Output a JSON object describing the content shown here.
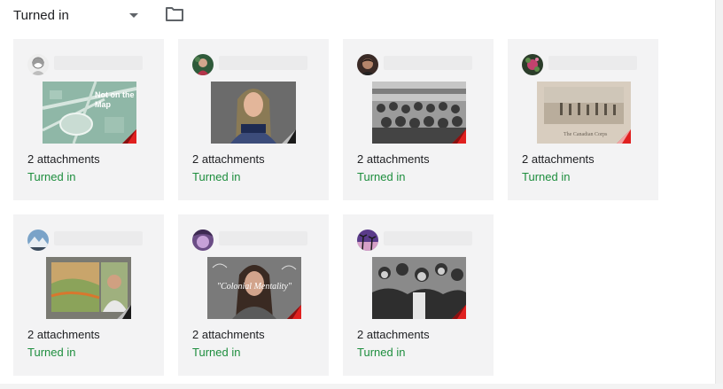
{
  "filter": {
    "selected": "Turned in"
  },
  "colors": {
    "status": "#1e8e3e",
    "card_bg": "#f3f3f4"
  },
  "cards": [
    {
      "attachments": "2 attachments",
      "status": "Turned in",
      "thumb_text": "Not on the Map"
    },
    {
      "attachments": "2 attachments",
      "status": "Turned in"
    },
    {
      "attachments": "2 attachments",
      "status": "Turned in"
    },
    {
      "attachments": "2 attachments",
      "status": "Turned in",
      "thumb_text": "The Canadian Corps"
    },
    {
      "attachments": "2 attachments",
      "status": "Turned in"
    },
    {
      "attachments": "2 attachments",
      "status": "Turned in",
      "thumb_text": "\"Colonial Mentality\""
    },
    {
      "attachments": "2 attachments",
      "status": "Turned in"
    }
  ]
}
